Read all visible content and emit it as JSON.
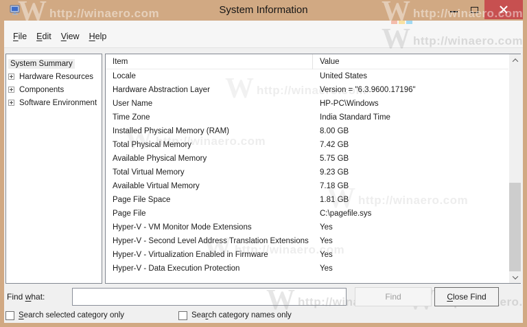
{
  "window": {
    "title": "System Information"
  },
  "menu": {
    "items": [
      {
        "pre": "",
        "accel": "F",
        "post": "ile"
      },
      {
        "pre": "",
        "accel": "E",
        "post": "dit"
      },
      {
        "pre": "",
        "accel": "V",
        "post": "iew"
      },
      {
        "pre": "",
        "accel": "H",
        "post": "elp"
      }
    ]
  },
  "sidebar": {
    "items": [
      {
        "label": "System Summary",
        "has_expander": false,
        "selected": true
      },
      {
        "label": "Hardware Resources",
        "has_expander": true,
        "selected": false
      },
      {
        "label": "Components",
        "has_expander": true,
        "selected": false
      },
      {
        "label": "Software Environment",
        "has_expander": true,
        "selected": false
      }
    ]
  },
  "table": {
    "columns": {
      "item": "Item",
      "value": "Value"
    },
    "rows": [
      {
        "item": "Locale",
        "value": "United States"
      },
      {
        "item": "Hardware Abstraction Layer",
        "value": "Version = \"6.3.9600.17196\""
      },
      {
        "item": "User Name",
        "value": "HP-PC\\Windows"
      },
      {
        "item": "Time Zone",
        "value": "India Standard Time"
      },
      {
        "item": "Installed Physical Memory (RAM)",
        "value": "8.00 GB"
      },
      {
        "item": "Total Physical Memory",
        "value": "7.42 GB"
      },
      {
        "item": "Available Physical Memory",
        "value": "5.75 GB"
      },
      {
        "item": "Total Virtual Memory",
        "value": "9.23 GB"
      },
      {
        "item": "Available Virtual Memory",
        "value": "7.18 GB"
      },
      {
        "item": "Page File Space",
        "value": "1.81 GB"
      },
      {
        "item": "Page File",
        "value": "C:\\pagefile.sys"
      },
      {
        "item": "Hyper-V - VM Monitor Mode Extensions",
        "value": "Yes"
      },
      {
        "item": "Hyper-V - Second Level Address Translation Extensions",
        "value": "Yes"
      },
      {
        "item": "Hyper-V - Virtualization Enabled in Firmware",
        "value": "Yes"
      },
      {
        "item": "Hyper-V - Data Execution Protection",
        "value": "Yes"
      }
    ]
  },
  "find": {
    "label": {
      "pre": "Find ",
      "accel": "w",
      "post": "hat:"
    },
    "input_value": "",
    "input_placeholder": "",
    "find_button": "Find",
    "close_button": {
      "pre": "",
      "accel": "C",
      "post": "lose Find"
    }
  },
  "checkboxes": [
    {
      "pre": "",
      "accel": "S",
      "post": "earch selected category only",
      "checked": false
    },
    {
      "pre": "Sea",
      "accel": "r",
      "post": "ch category names only",
      "checked": false
    }
  ],
  "watermark": {
    "text": "http://winaero.com",
    "logo": "W"
  },
  "colors": {
    "titlebar_tan": "#d1a983",
    "close_red": "#c75050",
    "dialog_bg": "#f0f0f0",
    "menu_bg": "#f6f6f6",
    "panel_border": "#828790",
    "text_dark": "#1b1b1b",
    "disabled_text": "#9d9d9d",
    "selected_bg": "#ededed",
    "scroll_thumb": "#cdcdcd"
  }
}
